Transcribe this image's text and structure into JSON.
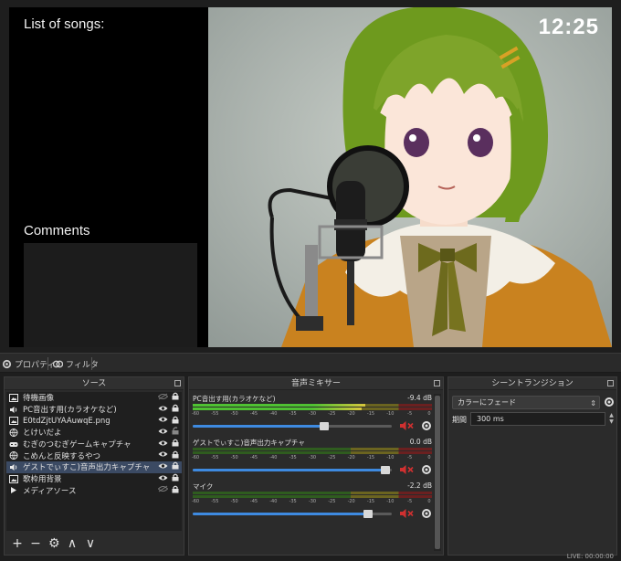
{
  "preview": {
    "songs_title": "List of songs:",
    "comments_title": "Comments",
    "clock": "12:25"
  },
  "toolbar": {
    "properties_label": "プロパティ",
    "filters_label": "フィルタ"
  },
  "sources": {
    "title": "ソース",
    "items": [
      {
        "name": "待機画像",
        "icon": "image-icon",
        "visible": false,
        "locked": true
      },
      {
        "name": "PC音出す用(カラオケなど)",
        "icon": "speaker-icon",
        "visible": true,
        "locked": true
      },
      {
        "name": "E0tdZjtUYAAuwqE.png",
        "icon": "image-icon",
        "visible": true,
        "locked": true
      },
      {
        "name": "とけいだよ",
        "icon": "globe-icon",
        "visible": true,
        "locked": false
      },
      {
        "name": "むぎのつむぎゲームキャプチャ",
        "icon": "gamepad-icon",
        "visible": true,
        "locked": true
      },
      {
        "name": "こめんと反映するやつ",
        "icon": "globe-icon",
        "visible": true,
        "locked": true
      },
      {
        "name": "ゲストでぃすこ)音声出力キャプチャ",
        "icon": "speaker-icon",
        "visible": true,
        "locked": true,
        "selected": true
      },
      {
        "name": "歌枠用背景",
        "icon": "image-icon",
        "visible": true,
        "locked": true
      },
      {
        "name": "メディアソース",
        "icon": "play-icon",
        "visible": false,
        "locked": true
      }
    ],
    "footer": [
      "+",
      "−",
      "⚙",
      "∧",
      "∨"
    ]
  },
  "mixer": {
    "title": "音声ミキサー",
    "ticks": [
      "-60",
      "-55",
      "-50",
      "-45",
      "-40",
      "-35",
      "-30",
      "-25",
      "-20",
      "-15",
      "-10",
      "-5",
      "0"
    ],
    "channels": [
      {
        "name": "PC音出す用(カラオケなど)",
        "db": "-9.4 dB",
        "level": 0.72,
        "volume": 0.66,
        "muted": true
      },
      {
        "name": "ゲストでぃすこ)音声出力キャプチャ",
        "db": "0.0 dB",
        "level": 0.0,
        "volume": 0.97,
        "muted": true
      },
      {
        "name": "マイク",
        "db": "-2.2 dB",
        "level": 0.0,
        "volume": 0.88,
        "muted": true
      }
    ]
  },
  "transitions": {
    "title": "シーントランジション",
    "selected": "カラーにフェード",
    "duration_label": "期間",
    "duration_value": "300 ms"
  },
  "status": {
    "live": "LIVE: 00:00:00"
  },
  "colors": {
    "background": "#1e1e1e",
    "dock": "#2b2b2b",
    "selection": "#3b4a63",
    "volume_blue": "#3e8ae0",
    "mute_red": "#d03030"
  }
}
